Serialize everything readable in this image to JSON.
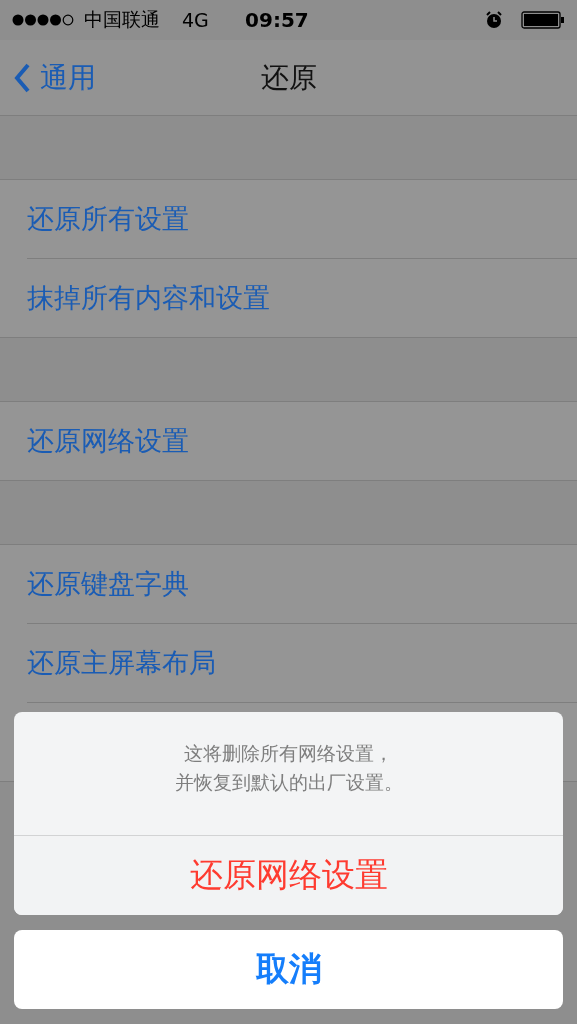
{
  "status_bar": {
    "carrier": "中国联通",
    "network": "4G",
    "time": "09:57"
  },
  "nav": {
    "back": "通用",
    "title": "还原"
  },
  "groups": [
    {
      "items": [
        "还原所有设置",
        "抹掉所有内容和设置"
      ]
    },
    {
      "items": [
        "还原网络设置"
      ]
    },
    {
      "items": [
        "还原键盘字典",
        "还原主屏幕布局"
      ]
    }
  ],
  "action_sheet": {
    "message": [
      "这将删除所有网络设置，",
      "并恢复到默认的出厂设置。"
    ],
    "destructive": "还原网络设置",
    "cancel": "取消"
  }
}
